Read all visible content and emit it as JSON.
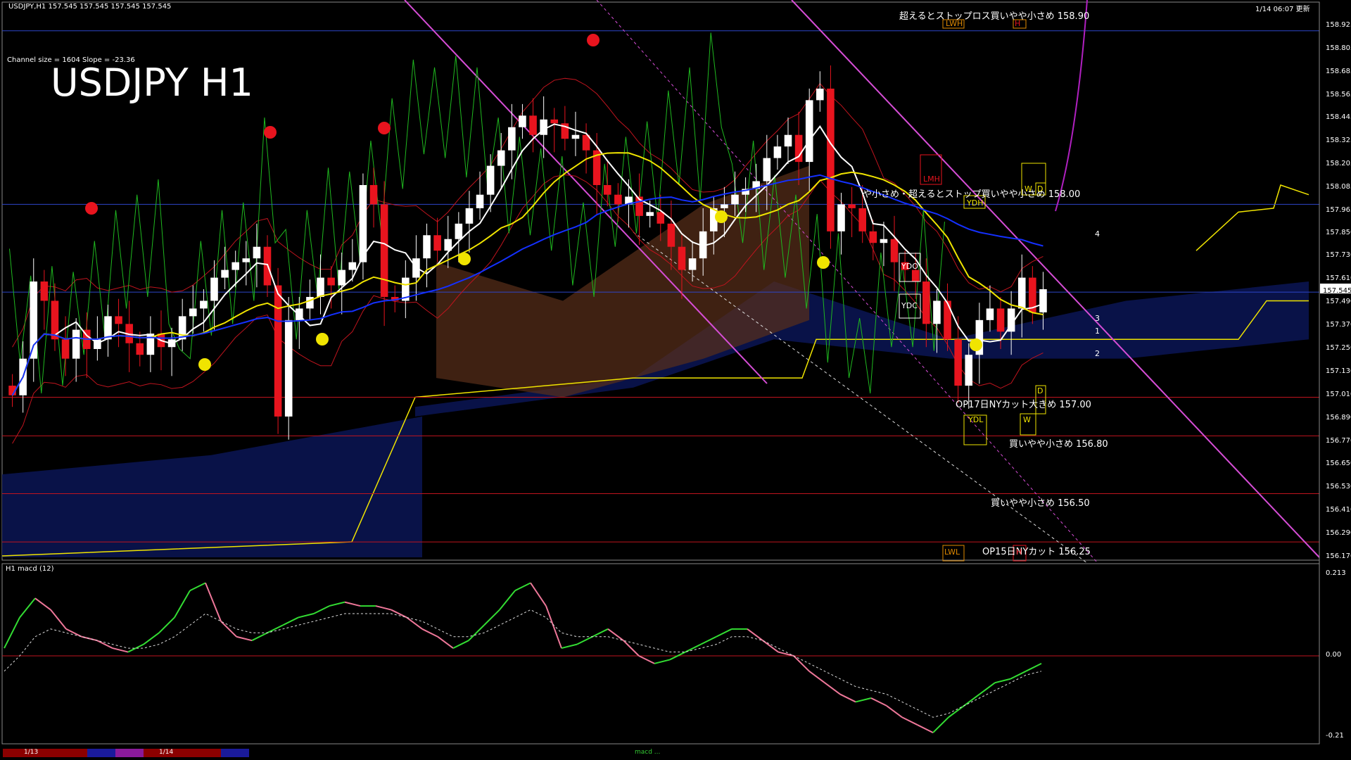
{
  "window": {
    "symbol_line": "USDJPY,H1  157.545 157.545 157.545 157.545",
    "datetime": "1/14 06:07 更新",
    "channel_info": "Channel size = 1604 Slope = -23.36",
    "big_title": "USDJPY H1",
    "subwindow_label": "H1  macd (12)"
  },
  "colors": {
    "background": "#000000",
    "bull_candle": "#ffffff",
    "bear_candle": "#e8141e",
    "ma_white": "#ffffff",
    "ma_yellow": "#f0e400",
    "ma_blue": "#1430ff",
    "channel_magenta": "#d64dd6",
    "macd_up": "#33dd33",
    "macd_down": "#ee7799",
    "level_red": "#c0141e",
    "level_blue": "#2d46c8"
  },
  "price_axis": {
    "ticks": [
      "158.925",
      "158.805",
      "158.685",
      "158.565",
      "158.445",
      "158.325",
      "158.205",
      "158.085",
      "157.965",
      "157.850",
      "157.730",
      "157.610",
      "157.545",
      "157.490",
      "157.370",
      "157.250",
      "157.130",
      "157.010",
      "156.890",
      "156.770",
      "156.650",
      "156.530",
      "156.410",
      "156.290",
      "156.170"
    ],
    "current": "157.545"
  },
  "macd_axis": {
    "ticks": [
      "0.213",
      "0.00",
      "-0.21"
    ]
  },
  "levels": [
    {
      "text": "超えるとストップロス買いやや小さめ 158.90"
    },
    {
      "text": "や小さめ・超えるとストップ買いやや小さめ 158.00"
    },
    {
      "text": "OP17日NYカット大きめ 157.00"
    },
    {
      "text": "買いやや小さめ 156.80"
    },
    {
      "text": "買いやや小さめ 156.50"
    },
    {
      "text": "OP15日NYカット 156.25"
    }
  ],
  "box_labels": [
    "LWH",
    "H",
    "LMH",
    "YDH",
    "W",
    "D",
    "YDO",
    "YDC",
    "YDL",
    "D",
    "W",
    "LWL",
    "H"
  ],
  "projection_numbers": [
    "4",
    "3",
    "1",
    "2"
  ],
  "footer": {
    "date1": "1/13",
    "date2": "1/14",
    "legend": "macd ..."
  },
  "chart_data": {
    "type": "candlestick",
    "symbol": "USDJPY",
    "timeframe": "H1",
    "ylim": [
      156.17,
      158.95
    ],
    "candles_close": [
      157.01,
      157.2,
      157.6,
      157.5,
      157.3,
      157.2,
      157.35,
      157.25,
      157.3,
      157.42,
      157.38,
      157.28,
      157.22,
      157.33,
      157.26,
      157.3,
      157.42,
      157.46,
      157.5,
      157.62,
      157.66,
      157.7,
      157.72,
      157.78,
      157.58,
      156.9,
      157.4,
      157.46,
      157.52,
      157.62,
      157.58,
      157.66,
      157.7,
      158.1,
      158.0,
      157.52,
      157.5,
      157.62,
      157.72,
      157.84,
      157.76,
      157.82,
      157.9,
      157.98,
      158.05,
      158.2,
      158.28,
      158.4,
      158.46,
      158.36,
      158.44,
      158.42,
      158.34,
      158.36,
      158.28,
      158.1,
      158.05,
      158.0,
      158.04,
      157.94,
      157.96,
      157.9,
      157.78,
      157.66,
      157.72,
      157.86,
      157.98,
      158.0,
      158.05,
      158.08,
      158.12,
      158.24,
      158.3,
      158.36,
      158.22,
      158.54,
      158.6,
      157.86,
      158.0,
      157.98,
      157.86,
      157.8,
      157.82,
      157.7,
      157.66,
      157.6,
      157.38,
      157.5,
      157.3,
      157.06,
      157.22,
      157.4,
      157.46,
      157.34,
      157.46,
      157.62,
      157.44,
      157.56
    ],
    "macd_main": [
      0.02,
      0.1,
      0.15,
      0.12,
      0.07,
      0.05,
      0.04,
      0.02,
      0.01,
      0.03,
      0.06,
      0.1,
      0.17,
      0.19,
      0.09,
      0.05,
      0.04,
      0.06,
      0.08,
      0.1,
      0.11,
      0.13,
      0.14,
      0.13,
      0.13,
      0.12,
      0.1,
      0.07,
      0.05,
      0.02,
      0.04,
      0.08,
      0.12,
      0.17,
      0.19,
      0.13,
      0.02,
      0.03,
      0.05,
      0.07,
      0.04,
      0.0,
      -0.02,
      -0.01,
      0.01,
      0.03,
      0.05,
      0.07,
      0.07,
      0.04,
      0.01,
      0.0,
      -0.04,
      -0.07,
      -0.1,
      -0.12,
      -0.11,
      -0.13,
      -0.16,
      -0.18,
      -0.2,
      -0.16,
      -0.13,
      -0.1,
      -0.07,
      -0.06,
      -0.04,
      -0.02
    ],
    "macd_signal": [
      -0.04,
      0.0,
      0.05,
      0.07,
      0.06,
      0.05,
      0.04,
      0.03,
      0.02,
      0.02,
      0.03,
      0.05,
      0.08,
      0.11,
      0.09,
      0.07,
      0.06,
      0.06,
      0.07,
      0.08,
      0.09,
      0.1,
      0.11,
      0.11,
      0.11,
      0.11,
      0.1,
      0.09,
      0.07,
      0.05,
      0.05,
      0.06,
      0.08,
      0.1,
      0.12,
      0.1,
      0.06,
      0.05,
      0.05,
      0.05,
      0.04,
      0.03,
      0.02,
      0.01,
      0.01,
      0.02,
      0.03,
      0.05,
      0.05,
      0.04,
      0.02,
      0.0,
      -0.02,
      -0.04,
      -0.06,
      -0.08,
      -0.09,
      -0.1,
      -0.12,
      -0.14,
      -0.16,
      -0.15,
      -0.13,
      -0.11,
      -0.09,
      -0.07,
      -0.05,
      -0.04
    ]
  }
}
